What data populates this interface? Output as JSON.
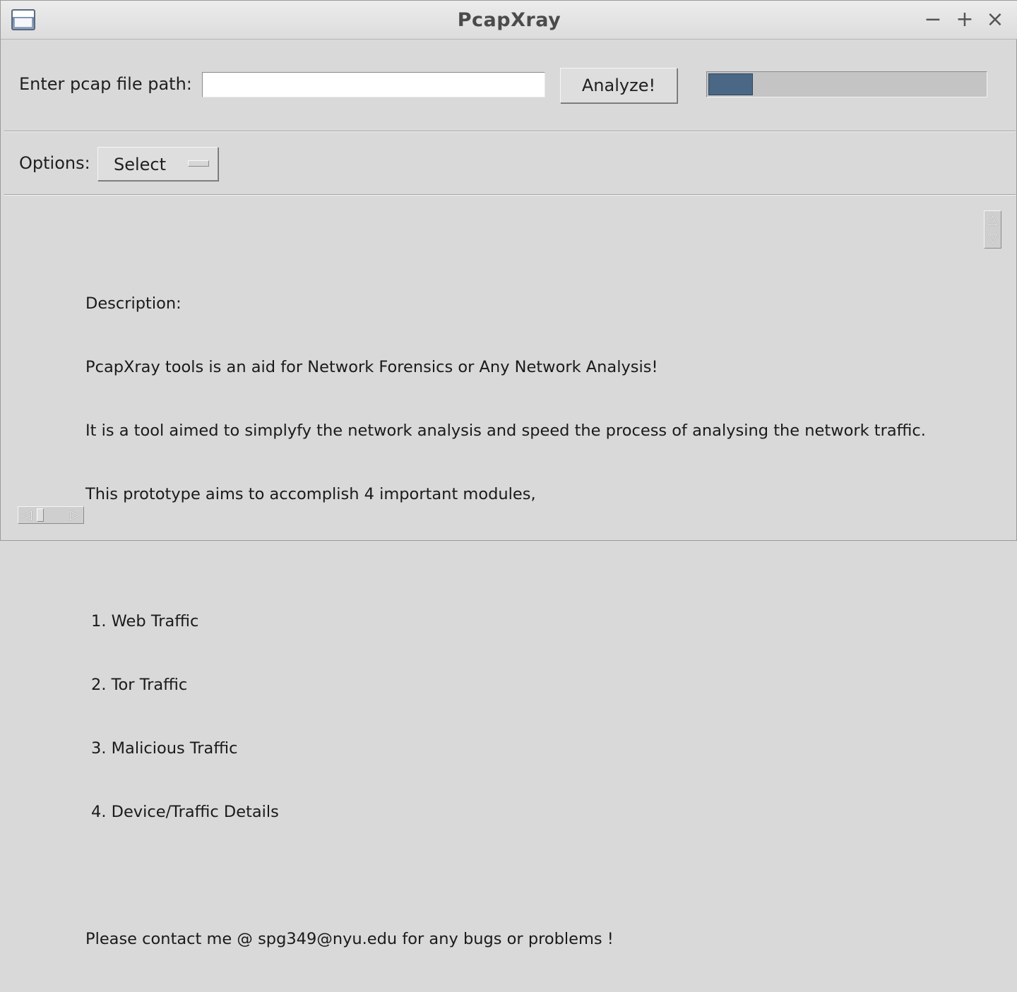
{
  "window": {
    "title": "PcapXray",
    "minimize_glyph": "−",
    "maximize_glyph": "+",
    "close_glyph": "×"
  },
  "file_row": {
    "label": "Enter pcap file path:",
    "input_value": "",
    "analyze_label": "Analyze!",
    "progress_fraction": 0.16
  },
  "options_row": {
    "label": "Options:",
    "select_value": "Select"
  },
  "description": {
    "heading": "Description:",
    "line1": "PcapXray tools is an aid for Network Forensics or Any Network Analysis!",
    "line2": "It is a tool aimed to simplyfy the network analysis and speed the process of analysing the network traffic.",
    "line3": "This prototype aims to accomplish 4 important modules,",
    "modules": [
      "1. Web Traffic",
      "2. Tor Traffic",
      "3. Malicious Traffic",
      "4. Device/Traffic Details"
    ],
    "contact": "Please contact me @ spg349@nyu.edu for any bugs or problems !"
  },
  "scrollbars": {
    "up_glyph": "△",
    "down_glyph": "▽",
    "left_glyph": "◁",
    "right_glyph": "▷"
  },
  "colors": {
    "background": "#d9d9d9",
    "progress_fill": "#4a6785",
    "progress_track": "#c4c4c4"
  },
  "icons": {
    "app": "window-app-icon",
    "minimize": "minimize-icon",
    "maximize": "maximize-icon",
    "close": "close-icon"
  }
}
